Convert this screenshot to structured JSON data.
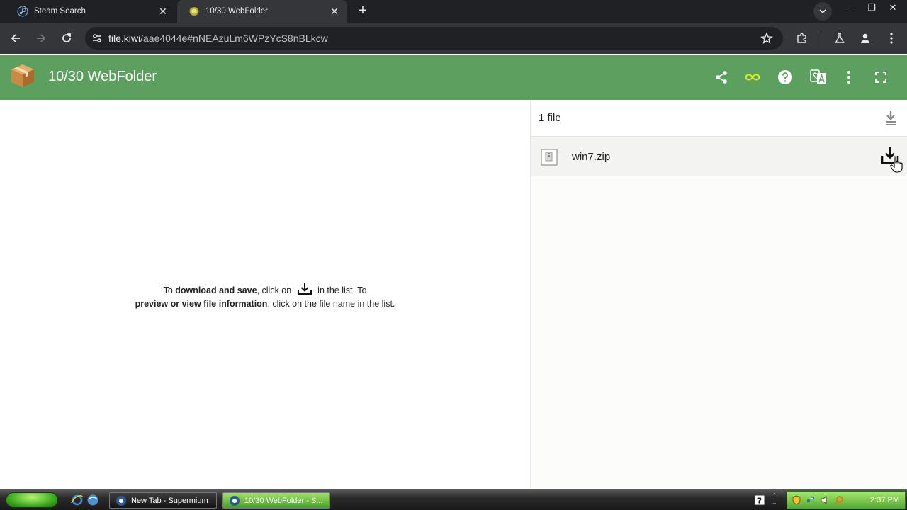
{
  "browser": {
    "tabs": [
      {
        "title": "Steam Search",
        "active": false
      },
      {
        "title": "10/30 WebFolder",
        "active": true
      }
    ],
    "new_tab_symbol": "+",
    "window_controls": {
      "minimize": "—",
      "restore": "❐",
      "close": "✕"
    },
    "url_host": "file.kiwi",
    "url_path": "/aae4044e#nNEAzuLm6WPzYcS8nBLkcw"
  },
  "app": {
    "title": "10/30 WebFolder",
    "header_icons": [
      "share-icon",
      "infinity-icon",
      "help-icon",
      "translate-icon",
      "more-vert-icon",
      "fullscreen-icon"
    ],
    "accent_color": "#5c9f5f",
    "infinity_color": "#d4ea2a"
  },
  "hint": {
    "part1": "To ",
    "bold1": "download and save",
    "part2": ", click on ",
    "part3": " in the list. To ",
    "bold2": "preview or view file information",
    "part4": ", click on the file name in the list."
  },
  "file_panel": {
    "count_label": "1 file",
    "files": [
      {
        "name": "win7.zip"
      }
    ]
  },
  "taskbar": {
    "items": [
      {
        "label": "New Tab - Supermium",
        "active": false
      },
      {
        "label": "10/30 WebFolder - S...",
        "active": true
      }
    ],
    "clock": "2:37 PM"
  }
}
